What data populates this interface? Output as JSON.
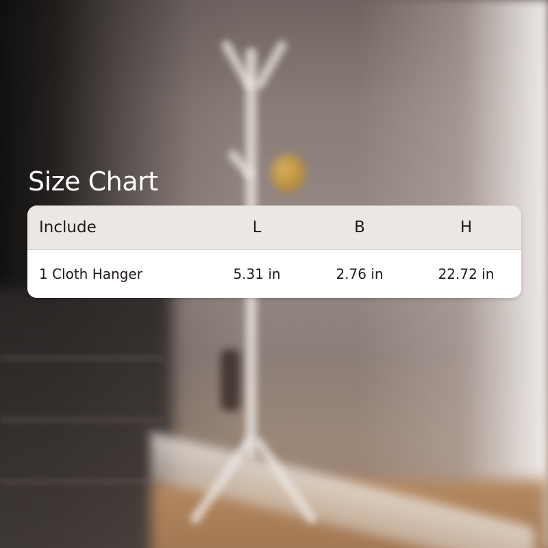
{
  "title": "Size Chart",
  "table": {
    "headers": [
      "Include",
      "L",
      "B",
      "H"
    ],
    "rows": [
      [
        "1 Cloth Hanger",
        "5.31 in",
        "2.76 in",
        "22.72 in"
      ]
    ]
  },
  "colors": {
    "header_bg": "#ebe8e3",
    "body_bg": "#ffffff",
    "title_text": "#ffffff",
    "table_text": "#1f1a17"
  }
}
